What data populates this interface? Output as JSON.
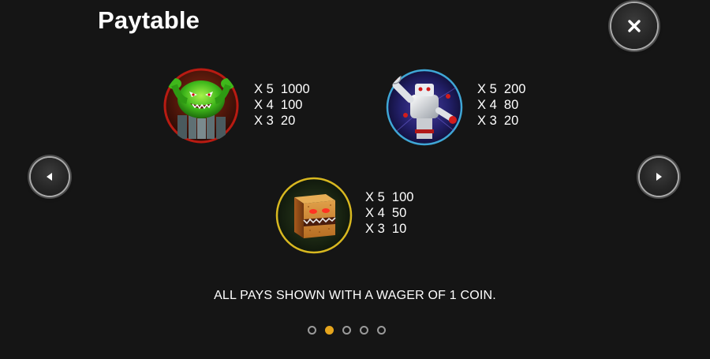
{
  "title": "Paytable",
  "buttons": {
    "close_icon": "close-icon",
    "prev_icon": "arrow-left-icon",
    "next_icon": "arrow-right-icon"
  },
  "symbols": [
    {
      "icon": "green-monster-icon",
      "pays": [
        "X 5  1000",
        "X 4  100",
        "X 3  20"
      ]
    },
    {
      "icon": "robot-icon",
      "pays": [
        "X 5  200",
        "X 4  80",
        "X 3  20"
      ]
    },
    {
      "icon": "box-monster-icon",
      "pays": [
        "X 5  100",
        "X 4  50",
        "X 3  10"
      ]
    }
  ],
  "footer_note": "ALL PAYS SHOWN WITH A WAGER OF 1 COIN.",
  "pagination": {
    "total": 5,
    "current": 2
  },
  "colors": {
    "background": "#151515",
    "active_dot": "#e6a51d",
    "text": "#ffffff"
  }
}
